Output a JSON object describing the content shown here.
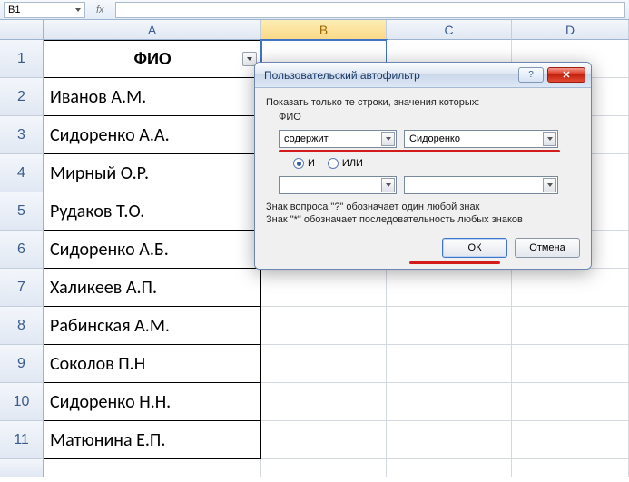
{
  "formula_bar": {
    "cell_ref": "B1",
    "fx_label": "fx",
    "formula": ""
  },
  "columns": [
    "A",
    "B",
    "C",
    "D"
  ],
  "active_column": "B",
  "sheet": {
    "header": "ФИО",
    "rows": [
      "Иванов А.М.",
      "Сидоренко А.А.",
      "Мирный О.Р.",
      "Рудаков Т.О.",
      "Сидоренко А.Б.",
      "Халикеев А.П.",
      "Рабинская А.М.",
      "Соколов П.Н",
      "Сидоренко Н.Н.",
      "Матюнина Е.П."
    ]
  },
  "dialog": {
    "title": "Пользовательский автофильтр",
    "help_symbol": "?",
    "close_symbol": "✕",
    "prompt": "Показать только те строки, значения которых:",
    "field_name": "ФИО",
    "cond1_op": "содержит",
    "cond1_val": "Сидоренко",
    "logic_and": "И",
    "logic_or": "ИЛИ",
    "cond2_op": "",
    "cond2_val": "",
    "hint1": "Знак вопроса \"?\" обозначает один любой знак",
    "hint2": "Знак \"*\" обозначает последовательность любых знаков",
    "ok": "ОК",
    "cancel": "Отмена"
  }
}
